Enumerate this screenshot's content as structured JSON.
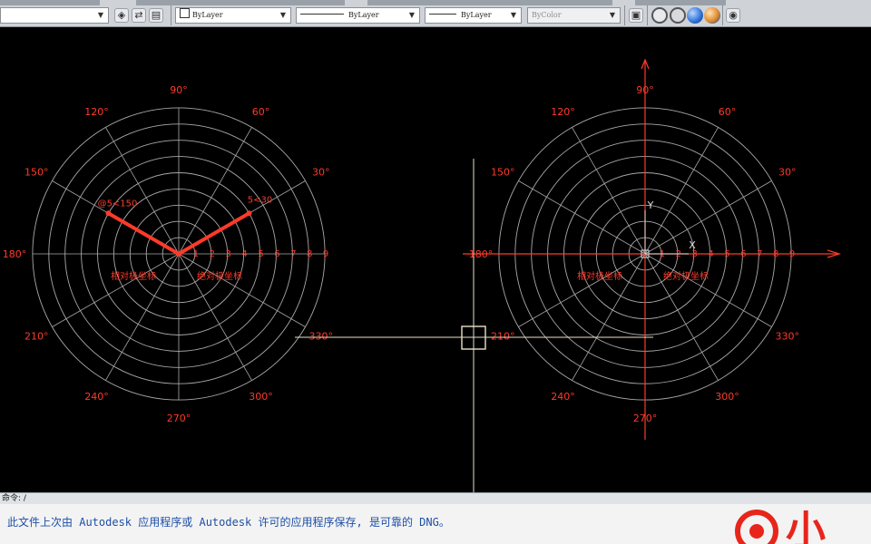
{
  "toolbar": {
    "layer_value": "ByLayer",
    "linetype_value": "ByLayer",
    "lineweight_value": "ByLayer",
    "color_value": "ByColor",
    "colors": {
      "face": "#cfd3d8",
      "accent_blue": "#2a6fd6",
      "accent_orange": "#e08a2a"
    }
  },
  "drawing": {
    "colors": {
      "grid": "#a9a9a9",
      "label": "#ff3a2a",
      "ray": "#ff3a2a",
      "crosshair": "#e8e2c8"
    },
    "angle_labels": [
      "90°",
      "60°",
      "30°",
      "330°",
      "300°",
      "270°",
      "240°",
      "210°",
      "180°",
      "150°",
      "120°"
    ],
    "ring_numbers": [
      "1",
      "2",
      "3",
      "4",
      "5",
      "6",
      "7",
      "8",
      "9"
    ],
    "left_polar": {
      "point_a": "@5<150",
      "point_b": "5<30",
      "label_left": "相对极坐标",
      "label_right": "绝对极坐标"
    },
    "right_polar": {
      "axis_y": "Y",
      "axis_x": "X",
      "label_left": "相对极坐标",
      "label_right": "绝对极坐标"
    }
  },
  "command": {
    "prompt": "命令: /"
  },
  "status": {
    "message": "此文件上次由 Autodesk 应用程序或 Autodesk 许可的应用程序保存, 是可靠的 DNG。"
  },
  "logo": {
    "text": "小"
  }
}
